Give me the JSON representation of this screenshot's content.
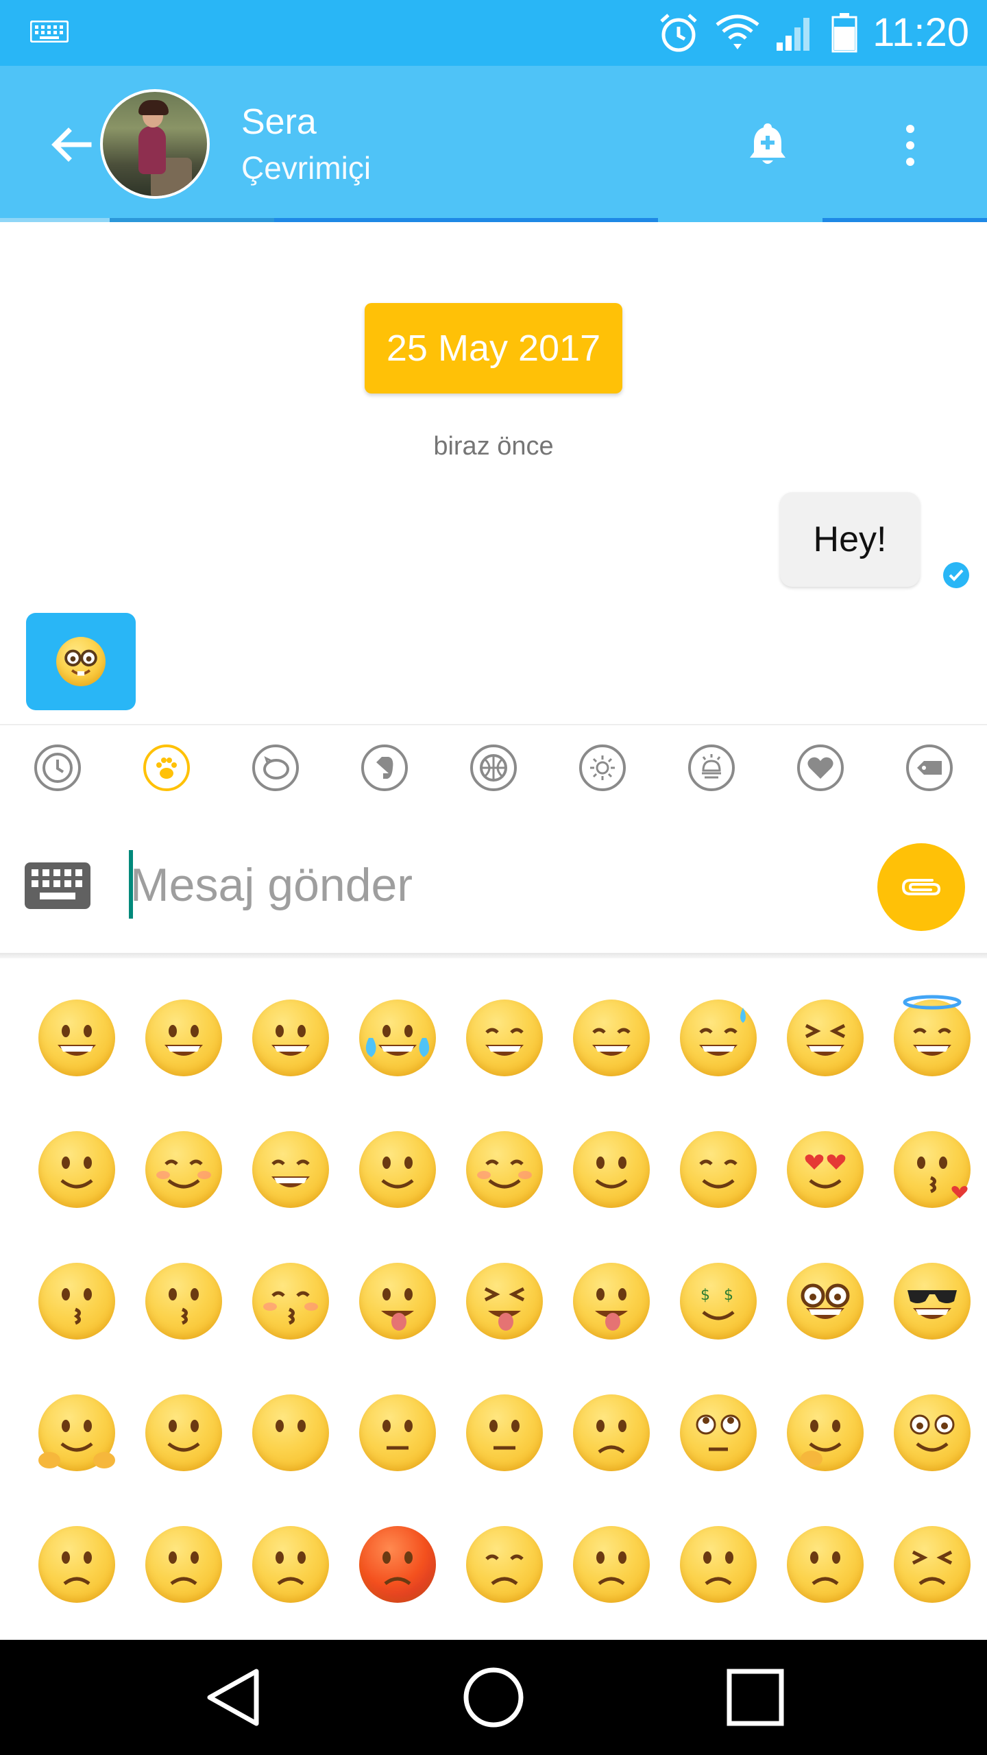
{
  "status_bar": {
    "time": "11:20",
    "icons": [
      "keyboard-icon",
      "alarm-icon",
      "wifi-icon",
      "signal-icon",
      "battery-icon"
    ]
  },
  "header": {
    "contact_name": "Sera",
    "contact_status": "Çevrimiçi",
    "colors": {
      "status_bar": "#29B6F6",
      "app_bar": "#4FC3F7"
    }
  },
  "chat": {
    "date_chip": "25 May 2017",
    "time_label": "biraz önce",
    "messages": [
      {
        "direction": "outgoing",
        "text": "Hey!",
        "status": "read"
      },
      {
        "direction": "incoming",
        "type": "emoji",
        "emoji_name": "nerd-face"
      }
    ]
  },
  "emoji_tabs": {
    "items": [
      "recent-clock-icon",
      "paw-icon",
      "piggy-icon",
      "evernote-icon",
      "basketball-icon",
      "sun-icon",
      "lamp-icon",
      "heart-icon",
      "tag-icon"
    ],
    "selected": "paw-icon",
    "accent": "#FFC107"
  },
  "composer": {
    "placeholder": "Mesaj gönder",
    "value": "",
    "attach_color": "#FFC107"
  },
  "emoji_grid": {
    "rows": [
      [
        "grinning-face",
        "grimacing-face",
        "grinning-squinting-teeth",
        "tears-of-joy",
        "smiley",
        "smile",
        "sweat-smile",
        "laughing",
        "innocent"
      ],
      [
        "wink",
        "blush",
        "slight-smile",
        "upside-down",
        "relaxed",
        "yum",
        "relieved",
        "heart-eyes",
        "kissing-heart"
      ],
      [
        "kissing",
        "kissing-smiling-eyes",
        "kissing-closed-eyes",
        "stuck-out-tongue-wink",
        "stuck-out-tongue-closed-eyes",
        "stuck-out-tongue",
        "money-mouth",
        "nerd-face",
        "sunglasses"
      ],
      [
        "hugging",
        "smirk",
        "no-mouth",
        "neutral",
        "expressionless",
        "unamused",
        "rolling-eyes",
        "thinking",
        "flushed"
      ],
      [
        "disappointed",
        "worried",
        "angry",
        "pouting",
        "pensive",
        "confused",
        "slight-frown",
        "frowning",
        "persevere"
      ]
    ]
  },
  "nav_bar": {
    "buttons": [
      "back-triangle-icon",
      "home-circle-icon",
      "recents-square-icon"
    ]
  }
}
